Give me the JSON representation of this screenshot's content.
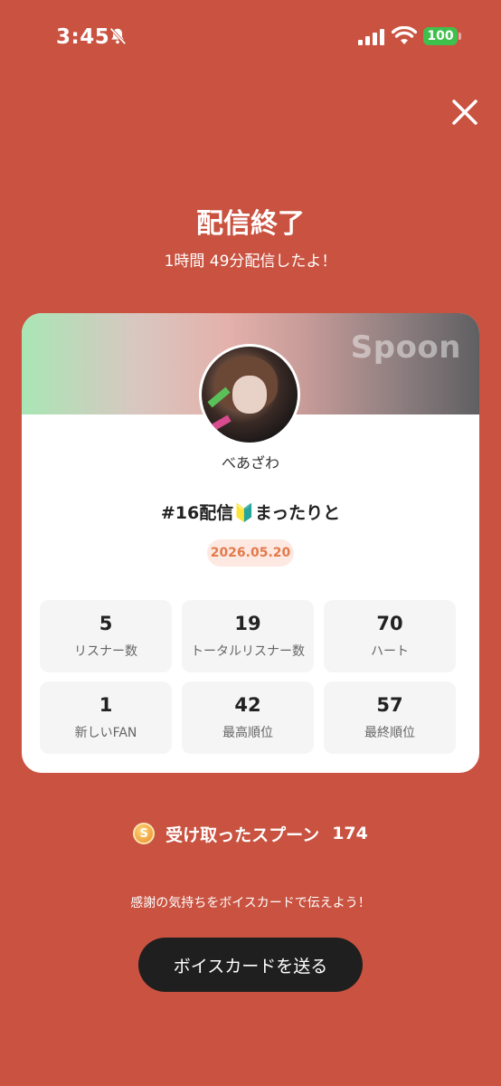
{
  "status_bar": {
    "time": "3:45",
    "battery": "100",
    "icons": [
      "bell-slash-icon",
      "signal-icon",
      "wifi-icon",
      "battery-icon"
    ]
  },
  "colors": {
    "background": "#c95240",
    "button": "#1f1f1f",
    "badge_text": "#e27a4c",
    "battery": "#3fc04c"
  },
  "header": {
    "title": "配信終了",
    "subtitle": "1時間 49分配信したよ！"
  },
  "card": {
    "brand": "Spoon",
    "username": "べあざわ",
    "live_title": "#16配信🔰まったりと",
    "date": "2026.05.20",
    "stats": [
      {
        "value": "5",
        "label": "リスナー数"
      },
      {
        "value": "19",
        "label": "トータルリスナー数"
      },
      {
        "value": "70",
        "label": "ハート"
      },
      {
        "value": "1",
        "label": "新しいFAN"
      },
      {
        "value": "42",
        "label": "最高順位"
      },
      {
        "value": "57",
        "label": "最終順位"
      }
    ]
  },
  "spoons": {
    "coin_symbol": "S",
    "label": "受け取ったスプーン",
    "count": "174"
  },
  "footer": {
    "message": "感謝の気持ちをボイスカードで伝えよう！",
    "button_label": "ボイスカードを送る"
  }
}
